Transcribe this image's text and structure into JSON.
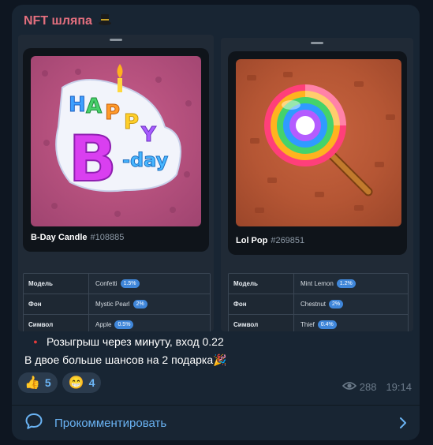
{
  "channel": {
    "name": "NFT шляпа",
    "hat_icon": "top-hat-icon"
  },
  "cards": [
    {
      "nft_name": "B-Day Candle",
      "nft_number": "#108885",
      "attributes": [
        {
          "label": "Модель",
          "value": "Confetti",
          "percent": "1.5%"
        },
        {
          "label": "Фон",
          "value": "Mystic Pearl",
          "percent": "2%"
        },
        {
          "label": "Символ",
          "value": "Apple",
          "percent": "0.5%"
        }
      ]
    },
    {
      "nft_name": "Lol Pop",
      "nft_number": "#269851",
      "attributes": [
        {
          "label": "Модель",
          "value": "Mint Lemon",
          "percent": "1.2%"
        },
        {
          "label": "Фон",
          "value": "Chestnut",
          "percent": "2%"
        },
        {
          "label": "Символ",
          "value": "Thief",
          "percent": "0.4%"
        }
      ]
    }
  ],
  "message": {
    "line1": "Розыгрыш через минуту, вход 0.22",
    "line2": "В двое больше шансов на 2 подарка",
    "line2_emoji": "🎉"
  },
  "reactions": [
    {
      "emoji": "👍",
      "count": "5"
    },
    {
      "emoji": "😁",
      "count": "4"
    }
  ],
  "meta": {
    "views": "288",
    "time": "19:14"
  },
  "comment": {
    "label": "Прокомментировать"
  },
  "colors": {
    "accent": "#6ab3f3",
    "channel_name": "#e36f7e",
    "bubble": "#182533"
  }
}
